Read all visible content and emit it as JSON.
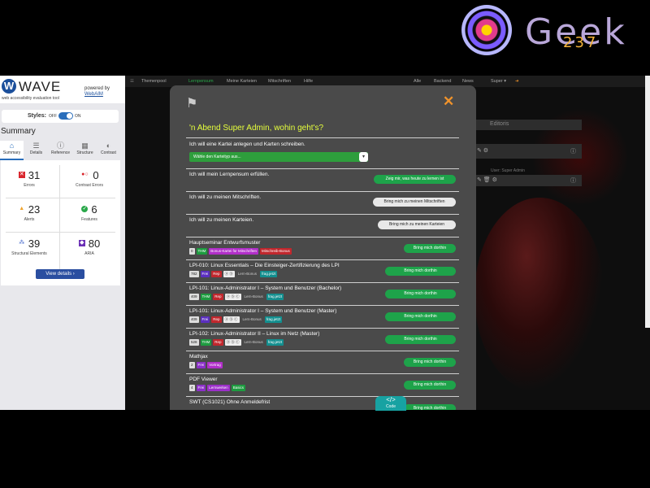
{
  "logo": {
    "text": "Geek",
    "number": "237"
  },
  "wave": {
    "name": "WAVE",
    "subtitle": "web accessibility evaluation tool",
    "powered_by": "powered by",
    "webaim": "WebAIM",
    "styles_label": "Styles:",
    "off": "OFF",
    "on": "ON",
    "summary_title": "Summary",
    "tabs": [
      {
        "label": "Summary",
        "icon": "⌂"
      },
      {
        "label": "Details",
        "icon": "☰"
      },
      {
        "label": "Reference",
        "icon": "ⓘ"
      },
      {
        "label": "Structure",
        "icon": "▦"
      },
      {
        "label": "Contrast",
        "icon": "◐"
      }
    ],
    "stats": [
      {
        "value": "31",
        "label": "Errors",
        "color": "#d9262d"
      },
      {
        "value": "0",
        "label": "Contrast Errors",
        "color": "#d9262d"
      },
      {
        "value": "23",
        "label": "Alerts",
        "color": "#f0a32b"
      },
      {
        "value": "6",
        "label": "Features",
        "color": "#2aa84a"
      },
      {
        "value": "39",
        "label": "Structural Elements",
        "color": "#3a5fc8"
      },
      {
        "value": "80",
        "label": "ARIA",
        "color": "#6a2fb5"
      }
    ],
    "view_details": "View details ›"
  },
  "app": {
    "nav": {
      "themenpool": "Themenpool",
      "lernpensum": "Lernpensum",
      "meine_karteien": "Meine Karteien",
      "mitschriften": "Mitschriften",
      "hilfe": "Hilfe",
      "alle": "Alle",
      "backend": "Backend",
      "news": "News",
      "super": "Super ▾"
    },
    "right_panel_title": "Editoris",
    "right_panel_sub": "User: Super Admin"
  },
  "modal": {
    "title": "'n Abend Super Admin, wohin geht's?",
    "r1_text": "Ich will eine Kartei anlegen und Karten schreiben.",
    "r1_select": "Wähle den Karteityp aus...",
    "r2_text": "Ich will mein Lernpensum erfüllen.",
    "r2_btn": "Zeig mir, was heute zu lernen ist",
    "r3_text": "Ich will zu meinen Mitschriften.",
    "r3_btn": "Bring mich zu meinen Mitschriften",
    "r4_text": "Ich will zu meinen Karteien.",
    "r4_btn": "Bring mich zu meinen Karteien",
    "bring": "Bring mich dorthin",
    "items": [
      {
        "title": "Hauptseminar Entwurfsmuster",
        "tags": [
          "0",
          "THM",
          "Bonus-Kartei für Mitschriften",
          "Mitschreib-Bonus"
        ]
      },
      {
        "title": "LPI-010: Linux Essentials – Die Einsteiger-Zertifizierung des LPI",
        "tags": [
          "782",
          "Frei",
          "Rep",
          "ⓐ ⓑ",
          "Lern-Bonus",
          "frag.jetzt"
        ]
      },
      {
        "title": "LPI-101: Linux-Administrator I – System und Benutzer (Bachelor)",
        "tags": [
          "409",
          "THM",
          "Rep",
          "ⓐ ⓑ ⓒ",
          "Lern-Bonus",
          "frag.jetzt"
        ]
      },
      {
        "title": "LPI-101: Linux-Administrator I – System und Benutzer (Master)",
        "tags": [
          "409",
          "Frei",
          "Rep",
          "ⓐ ⓑ ⓒ",
          "Lern-Bonus",
          "frag.jetzt"
        ]
      },
      {
        "title": "LPI-102: Linux-Administrator II – Linux im Netz (Master)",
        "tags": [
          "528",
          "THM",
          "Rep",
          "ⓐ ⓑ ⓒ",
          "Lern-Bonus",
          "frag.jetzt"
        ]
      },
      {
        "title": "Mathjax",
        "tags": [
          "2",
          "Frei",
          "Vortrag"
        ]
      },
      {
        "title": "PDF Viewer",
        "tags": [
          "4",
          "Frei",
          "Lernwerken",
          "Basics"
        ]
      },
      {
        "title": "SWT (CS1021) Ohne Anmeldefrist",
        "tags": []
      }
    ]
  },
  "code_button": {
    "icon": "</>",
    "label": "Code"
  }
}
